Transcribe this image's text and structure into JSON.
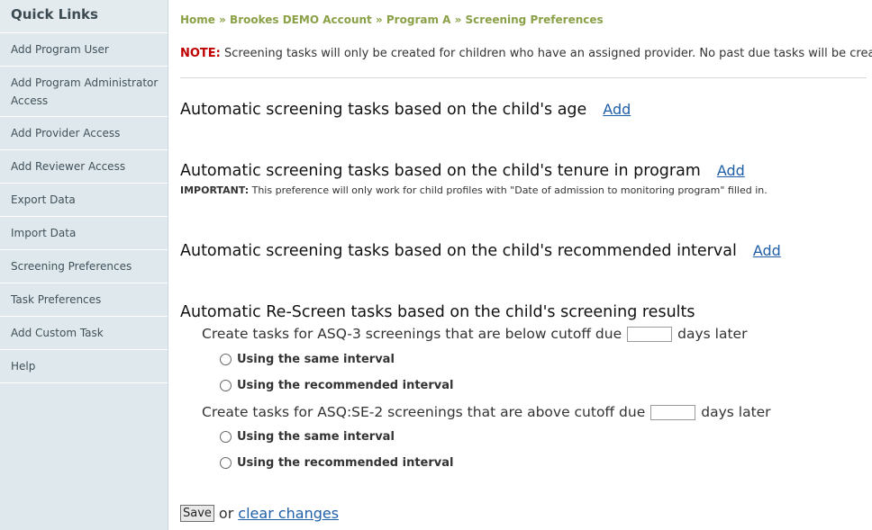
{
  "sidebar": {
    "title": "Quick Links",
    "items": [
      {
        "label": "Add Program User"
      },
      {
        "label": "Add Program Administrator Access"
      },
      {
        "label": "Add Provider Access"
      },
      {
        "label": "Add Reviewer Access"
      },
      {
        "label": "Export Data"
      },
      {
        "label": "Import Data"
      },
      {
        "label": "Screening Preferences"
      },
      {
        "label": "Task Preferences"
      },
      {
        "label": "Add Custom Task"
      },
      {
        "label": "Help"
      }
    ]
  },
  "breadcrumb": {
    "home": "Home",
    "account": "Brookes DEMO Account",
    "program": "Program A",
    "current": "Screening Preferences",
    "separator": " » "
  },
  "note": {
    "label": "NOTE:",
    "text": " Screening tasks will only be created for children who have an assigned provider. No past due tasks will be created."
  },
  "sections": {
    "age": {
      "title": "Automatic screening tasks based on the child's age",
      "add": "Add"
    },
    "tenure": {
      "title": "Automatic screening tasks based on the child's tenure in program",
      "add": "Add",
      "important_label": "IMPORTANT:",
      "important_text": " This preference will only work for child profiles with \"Date of admission to monitoring program\" filled in."
    },
    "interval": {
      "title": "Automatic screening tasks based on the child's recommended interval",
      "add": "Add"
    },
    "rescreen": {
      "title": "Automatic Re-Screen tasks based on the child's screening results",
      "asq3": {
        "prefix": "Create tasks for ASQ-3 screenings that are below cutoff due",
        "suffix": "days later",
        "value": "",
        "option_same": "Using the same interval",
        "option_recommended": "Using the recommended interval"
      },
      "asqse": {
        "prefix": "Create tasks for ASQ:SE-2 screenings that are above cutoff due",
        "suffix": "days later",
        "value": "",
        "option_same": "Using the same interval",
        "option_recommended": "Using the recommended interval"
      }
    }
  },
  "actions": {
    "save": "Save",
    "or": "or",
    "clear": "clear changes"
  }
}
